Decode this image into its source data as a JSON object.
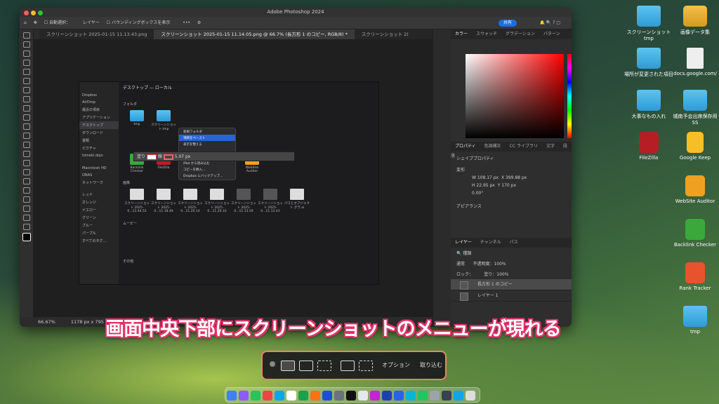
{
  "photoshop": {
    "window_title": "Adobe Photoshop 2024",
    "options_bar": {
      "auto_select": "自動選択：",
      "layer_select": "レイヤー",
      "bbox": "バウンディングボックスを表示",
      "share": "共有"
    },
    "tabs": [
      "スクリーンショット 2025-01-15 11.13.43.png",
      "スクリーンショット 2025-01-15 11.14.05.png @ 66.7% (長方形 1 のコピー, RGB/8) *",
      "スクリーンショット 2("
    ],
    "status": {
      "zoom": "66.67%",
      "size": "1178 px x 795 px (72 ppi)"
    },
    "color_panel": {
      "tabs": [
        "カラー",
        "スウォッチ",
        "グラデーション",
        "パターン"
      ]
    },
    "props_panel": {
      "tabs": [
        "プロパティ",
        "色調補正",
        "CC ライブラリ",
        "文字",
        "段落"
      ],
      "shape_props": "シェイププロパティ",
      "transform": "変形",
      "w": "W 108.17 px",
      "x": "X 399.88 px",
      "h": "H 22.95 px",
      "y": "Y 170 px",
      "angle": "0.00°",
      "appearance": "アピアランス"
    },
    "layers_panel": {
      "tabs": [
        "レイヤー",
        "チャンネル",
        "パス"
      ],
      "kind": "種類",
      "blend": "通常",
      "opacity_label": "不透明度：",
      "opacity": "100%",
      "lock_label": "ロック：",
      "fill_label": "塗り：",
      "fill": "100%",
      "layers": [
        "長方形 1 のコピー",
        "レイヤー 1"
      ]
    }
  },
  "finder": {
    "title": "デスクトップ — ローカル",
    "sidebar": [
      "Dropbox",
      "AirDrop",
      "最近の項目",
      "アプリケーション",
      "デスクトップ",
      "ダウンロード",
      "書類",
      "ピクチャ",
      "tomoki.dojo",
      "Macintosh HD",
      "ONAS",
      "ネットワーク",
      "レッド",
      "オレンジ",
      "イエロー",
      "グリーン",
      "ブルー",
      "パープル",
      "すべてのタグ..."
    ],
    "section_folders": "フォルダ",
    "folders": [
      "tmp",
      "スクリーンショット tmp"
    ],
    "apps": [
      "Backlink Checker",
      "FileZilla",
      "WebSite Auditor"
    ],
    "section_images": "画像",
    "images": [
      "スクリーンショット 2025-0...13.44.52",
      "スクリーンショット 2025-0...11.18.49",
      "スクリーンショット 2025-0...11.20.14",
      "スクリーンショット 2025-0...11.20.33",
      "スクリーンショット 2025-0...11.13.59",
      "スクリーンショット 2025-0...11.13.43",
      "パスとオブジェクト グラ.ai"
    ],
    "section_movies": "ムービー",
    "section_other": "その他",
    "context_menu": [
      "新規フォルダ",
      "項目をペースト",
      "表示を整える",
      "iPad から読み込む",
      "コピーを挿入...",
      "Dropbox にバックアップ..."
    ],
    "float_bar": {
      "fill": "塗り",
      "stroke": "線",
      "stroke_width": "5.07 px"
    }
  },
  "desktop_icons": [
    {
      "label": "スクリーンショット tmp",
      "type": "folder"
    },
    {
      "label": "画像データ集",
      "type": "drive"
    },
    {
      "label": "場所が変更された項目",
      "type": "folder"
    },
    {
      "label": "docs.google.com/",
      "type": "link"
    },
    {
      "label": "大事なもの入れ",
      "type": "folder"
    },
    {
      "label": "城南予会出席保存用 SS",
      "type": "folder"
    },
    {
      "label": "FileZilla",
      "type": "app"
    },
    {
      "label": "Google Keep",
      "type": "app"
    },
    {
      "label": "WebSite Auditor",
      "type": "app"
    },
    {
      "label": "Backlink Checker",
      "type": "app"
    },
    {
      "label": "Rank Tracker",
      "type": "app"
    },
    {
      "label": "tmp",
      "type": "folder"
    }
  ],
  "caption": "画面中央下部にスクリーンショットのメニューが現れる",
  "screenshot_toolbar": {
    "options": "オプション",
    "capture": "取り込む"
  },
  "colors": {
    "accent": "#e0346a",
    "highlight_border": "#f08268",
    "ps_bg": "#2b2b2b"
  }
}
